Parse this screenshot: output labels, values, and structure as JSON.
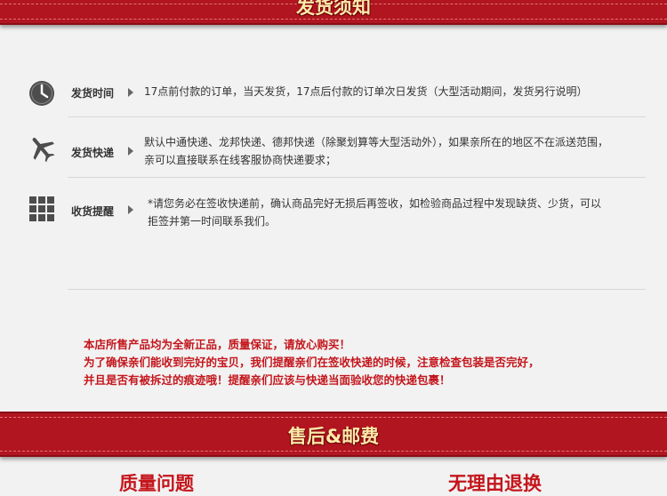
{
  "header": {
    "title": "发货须知"
  },
  "rows": [
    {
      "icon": "clock-icon",
      "label": "发货时间",
      "lines": [
        "17点前付款的订单，当天发货，17点后付款的订单次日发货（大型活动期间，发货另行说明）"
      ]
    },
    {
      "icon": "airplane-icon",
      "label": "发货快递",
      "lines": [
        "默认中通快递、龙邦快递、德邦快递（除聚划算等大型活动外），如果亲所在的地区不在派送范围，",
        "亲可以直接联系在线客服协商快递要求；"
      ]
    },
    {
      "icon": "grid-icon",
      "label": "收货提醒",
      "lines": [
        "*请您务必在签收快递前，确认商品完好无损后再签收，如检验商品过程中发现缺货、少货，可以",
        "拒签并第一时间联系我们。"
      ]
    }
  ],
  "notice": [
    "本店所售产品均为全新正品，质量保证，请放心购买！",
    "为了确保亲们能收到完好的宝贝，我们提醒亲们在签收快递的时候，注意检查包装是否完好，",
    "并且是否有被拆过的痕迹哦！提醒亲们应该与快递当面验收您的快递包裹！"
  ],
  "after_sales": {
    "title": "售后&邮费",
    "left_heading": "质量问题",
    "right_heading": "无理由退换"
  },
  "colors": {
    "banner": "#b1151f",
    "accent_text": "#c4161c",
    "banner_text": "#ffe9a8"
  }
}
